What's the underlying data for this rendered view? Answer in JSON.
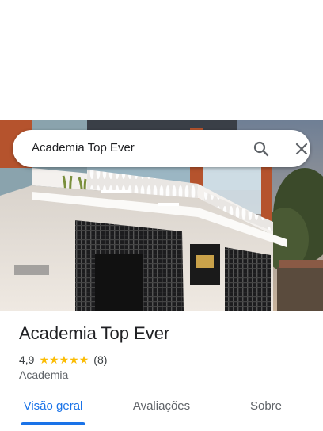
{
  "search": {
    "query": "Academia Top Ever"
  },
  "place": {
    "name": "Academia Top Ever",
    "rating": "4,9",
    "stars": 5,
    "review_count": "(8)",
    "category": "Academia"
  },
  "tabs": [
    {
      "label": "Visão geral",
      "active": true
    },
    {
      "label": "Avaliações",
      "active": false
    },
    {
      "label": "Sobre",
      "active": false
    }
  ],
  "colors": {
    "accent": "#1a73e8",
    "star": "#fbbc04",
    "text": "#202124",
    "secondary_text": "#5f6368"
  },
  "icons": [
    "search-icon",
    "close-icon",
    "star-icon"
  ]
}
